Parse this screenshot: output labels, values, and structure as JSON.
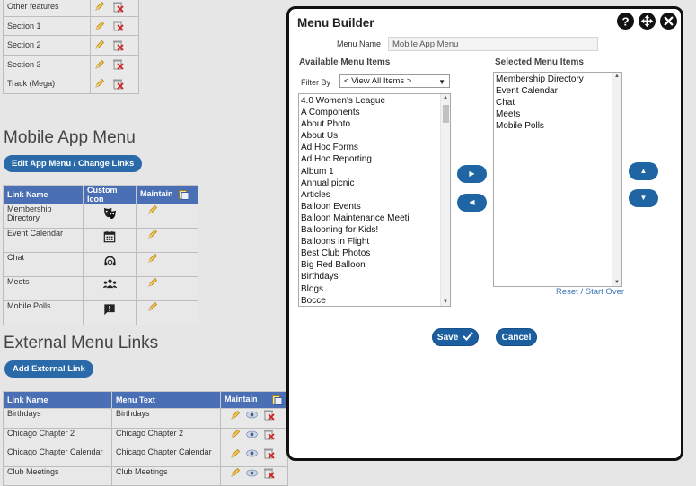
{
  "sections": [
    {
      "label": "Other features"
    },
    {
      "label": "Section 1"
    },
    {
      "label": "Section 2"
    },
    {
      "label": "Section 3"
    },
    {
      "label": "Track (Mega)"
    }
  ],
  "mobile": {
    "heading": "Mobile App Menu",
    "edit_button": "Edit App Menu / Change Links",
    "columns": [
      "Link Name",
      "Custom Icon",
      "Maintain"
    ],
    "rows": [
      {
        "name": "Membership Directory",
        "icon": "theater-masks-icon"
      },
      {
        "name": "Event Calendar",
        "icon": "calendar-icon"
      },
      {
        "name": "Chat",
        "icon": "headset-icon"
      },
      {
        "name": "Meets",
        "icon": "people-group-icon"
      },
      {
        "name": "Mobile Polls",
        "icon": "chat-bubble-icon"
      }
    ]
  },
  "external": {
    "heading": "External Menu Links",
    "add_button": "Add External Link",
    "columns": [
      "Link Name",
      "Menu Text",
      "Maintain"
    ],
    "rows": [
      {
        "name": "Birthdays",
        "text": "Birthdays"
      },
      {
        "name": "Chicago Chapter 2",
        "text": "Chicago Chapter 2"
      },
      {
        "name": "Chicago Chapter Calendar",
        "text": "Chicago Chapter Calendar"
      },
      {
        "name": "Club Meetings",
        "text": "Club Meetings"
      }
    ]
  },
  "modal": {
    "title": "Menu Builder",
    "header_icons": [
      "help-icon",
      "move-icon",
      "close-icon"
    ],
    "menu_name_label": "Menu Name",
    "menu_name_value": "Mobile App Menu",
    "available_header": "Available Menu Items",
    "selected_header": "Selected Menu Items",
    "filter_label": "Filter By",
    "filter_value": "< View All Items >",
    "available_items": [
      "4.0 Women's League",
      "A Components",
      "About Photo",
      "About Us",
      "Ad Hoc Forms",
      "Ad Hoc Reporting",
      "Album 1",
      "Annual picnic",
      "Articles",
      "Balloon Events",
      "Balloon Maintenance Meeti",
      "Ballooning for Kids!",
      "Balloons in Flight",
      "Best Club Photos",
      "Big Red Balloon",
      "Birthdays",
      "Blogs",
      "Bocce"
    ],
    "selected_items": [
      "Membership Directory",
      "Event Calendar",
      "Chat",
      "Meets",
      "Mobile Polls"
    ],
    "reset_label": "Reset / Start Over",
    "save_label": "Save",
    "cancel_label": "Cancel"
  }
}
